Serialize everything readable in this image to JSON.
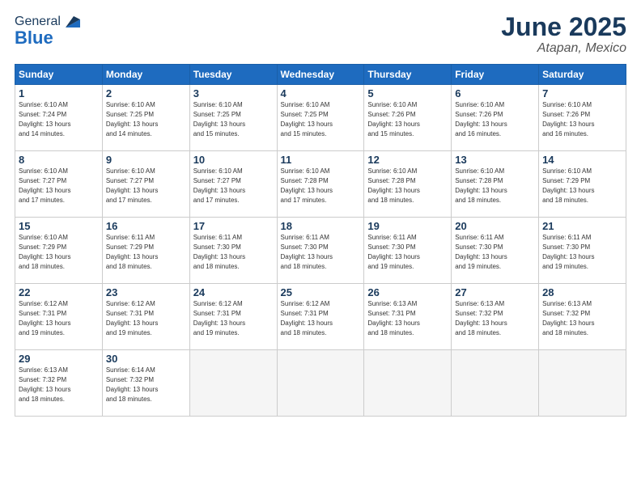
{
  "logo": {
    "general": "General",
    "blue": "Blue"
  },
  "header": {
    "title": "June 2025",
    "subtitle": "Atapan, Mexico"
  },
  "weekdays": [
    "Sunday",
    "Monday",
    "Tuesday",
    "Wednesday",
    "Thursday",
    "Friday",
    "Saturday"
  ],
  "weeks": [
    [
      {
        "day": 1,
        "sunrise": "6:10 AM",
        "sunset": "7:24 PM",
        "daylight": "13 hours and 14 minutes."
      },
      {
        "day": 2,
        "sunrise": "6:10 AM",
        "sunset": "7:25 PM",
        "daylight": "13 hours and 14 minutes."
      },
      {
        "day": 3,
        "sunrise": "6:10 AM",
        "sunset": "7:25 PM",
        "daylight": "13 hours and 15 minutes."
      },
      {
        "day": 4,
        "sunrise": "6:10 AM",
        "sunset": "7:25 PM",
        "daylight": "13 hours and 15 minutes."
      },
      {
        "day": 5,
        "sunrise": "6:10 AM",
        "sunset": "7:26 PM",
        "daylight": "13 hours and 15 minutes."
      },
      {
        "day": 6,
        "sunrise": "6:10 AM",
        "sunset": "7:26 PM",
        "daylight": "13 hours and 16 minutes."
      },
      {
        "day": 7,
        "sunrise": "6:10 AM",
        "sunset": "7:26 PM",
        "daylight": "13 hours and 16 minutes."
      }
    ],
    [
      {
        "day": 8,
        "sunrise": "6:10 AM",
        "sunset": "7:27 PM",
        "daylight": "13 hours and 17 minutes."
      },
      {
        "day": 9,
        "sunrise": "6:10 AM",
        "sunset": "7:27 PM",
        "daylight": "13 hours and 17 minutes."
      },
      {
        "day": 10,
        "sunrise": "6:10 AM",
        "sunset": "7:27 PM",
        "daylight": "13 hours and 17 minutes."
      },
      {
        "day": 11,
        "sunrise": "6:10 AM",
        "sunset": "7:28 PM",
        "daylight": "13 hours and 17 minutes."
      },
      {
        "day": 12,
        "sunrise": "6:10 AM",
        "sunset": "7:28 PM",
        "daylight": "13 hours and 18 minutes."
      },
      {
        "day": 13,
        "sunrise": "6:10 AM",
        "sunset": "7:28 PM",
        "daylight": "13 hours and 18 minutes."
      },
      {
        "day": 14,
        "sunrise": "6:10 AM",
        "sunset": "7:29 PM",
        "daylight": "13 hours and 18 minutes."
      }
    ],
    [
      {
        "day": 15,
        "sunrise": "6:10 AM",
        "sunset": "7:29 PM",
        "daylight": "13 hours and 18 minutes."
      },
      {
        "day": 16,
        "sunrise": "6:11 AM",
        "sunset": "7:29 PM",
        "daylight": "13 hours and 18 minutes."
      },
      {
        "day": 17,
        "sunrise": "6:11 AM",
        "sunset": "7:30 PM",
        "daylight": "13 hours and 18 minutes."
      },
      {
        "day": 18,
        "sunrise": "6:11 AM",
        "sunset": "7:30 PM",
        "daylight": "13 hours and 18 minutes."
      },
      {
        "day": 19,
        "sunrise": "6:11 AM",
        "sunset": "7:30 PM",
        "daylight": "13 hours and 19 minutes."
      },
      {
        "day": 20,
        "sunrise": "6:11 AM",
        "sunset": "7:30 PM",
        "daylight": "13 hours and 19 minutes."
      },
      {
        "day": 21,
        "sunrise": "6:11 AM",
        "sunset": "7:30 PM",
        "daylight": "13 hours and 19 minutes."
      }
    ],
    [
      {
        "day": 22,
        "sunrise": "6:12 AM",
        "sunset": "7:31 PM",
        "daylight": "13 hours and 19 minutes."
      },
      {
        "day": 23,
        "sunrise": "6:12 AM",
        "sunset": "7:31 PM",
        "daylight": "13 hours and 19 minutes."
      },
      {
        "day": 24,
        "sunrise": "6:12 AM",
        "sunset": "7:31 PM",
        "daylight": "13 hours and 19 minutes."
      },
      {
        "day": 25,
        "sunrise": "6:12 AM",
        "sunset": "7:31 PM",
        "daylight": "13 hours and 18 minutes."
      },
      {
        "day": 26,
        "sunrise": "6:13 AM",
        "sunset": "7:31 PM",
        "daylight": "13 hours and 18 minutes."
      },
      {
        "day": 27,
        "sunrise": "6:13 AM",
        "sunset": "7:32 PM",
        "daylight": "13 hours and 18 minutes."
      },
      {
        "day": 28,
        "sunrise": "6:13 AM",
        "sunset": "7:32 PM",
        "daylight": "13 hours and 18 minutes."
      }
    ],
    [
      {
        "day": 29,
        "sunrise": "6:13 AM",
        "sunset": "7:32 PM",
        "daylight": "13 hours and 18 minutes."
      },
      {
        "day": 30,
        "sunrise": "6:14 AM",
        "sunset": "7:32 PM",
        "daylight": "13 hours and 18 minutes."
      },
      null,
      null,
      null,
      null,
      null
    ]
  ],
  "labels": {
    "sunrise": "Sunrise:",
    "sunset": "Sunset:",
    "daylight": "Daylight:"
  }
}
